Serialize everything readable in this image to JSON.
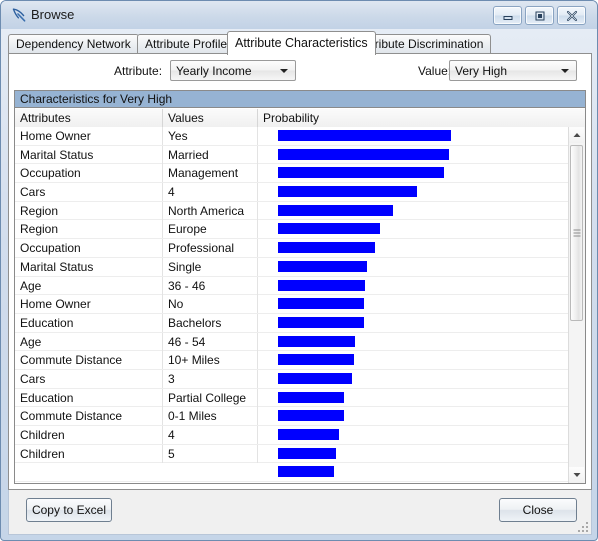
{
  "window": {
    "title": "Browse",
    "icon": "pickaxe-icon",
    "controls": {
      "minimize": "minimize-icon",
      "maximize": "restore-icon",
      "close": "close-icon"
    }
  },
  "tabs": [
    {
      "label": "Dependency Network",
      "active": false
    },
    {
      "label": "Attribute Profiles",
      "active": false
    },
    {
      "label": "Attribute Characteristics",
      "active": true
    },
    {
      "label": "Attribute Discrimination",
      "active": false
    }
  ],
  "selectors": {
    "attribute_label": "Attribute:",
    "attribute_value": "Yearly Income",
    "value_label": "Value:",
    "value_value": "Very High"
  },
  "grid": {
    "caption": "Characteristics for Very High",
    "columns": [
      "Attributes",
      "Values",
      "Probability"
    ],
    "rows": [
      {
        "attribute": "Home Owner",
        "value": "Yes",
        "probability": 0.985
      },
      {
        "attribute": "Marital Status",
        "value": "Married",
        "probability": 0.972
      },
      {
        "attribute": "Occupation",
        "value": "Management",
        "probability": 0.944
      },
      {
        "attribute": "Cars",
        "value": "4",
        "probability": 0.792
      },
      {
        "attribute": "Region",
        "value": "North America",
        "probability": 0.652
      },
      {
        "attribute": "Region",
        "value": "Europe",
        "probability": 0.578
      },
      {
        "attribute": "Occupation",
        "value": "Professional",
        "probability": 0.55
      },
      {
        "attribute": "Marital Status",
        "value": "Single",
        "probability": 0.505
      },
      {
        "attribute": "Age",
        "value": "36 - 46",
        "probability": 0.496
      },
      {
        "attribute": "Home Owner",
        "value": "No",
        "probability": 0.487
      },
      {
        "attribute": "Education",
        "value": "Bachelors",
        "probability": 0.487
      },
      {
        "attribute": "Age",
        "value": "46 - 54",
        "probability": 0.44
      },
      {
        "attribute": "Commute Distance",
        "value": "10+ Miles",
        "probability": 0.431
      },
      {
        "attribute": "Cars",
        "value": "3",
        "probability": 0.422
      },
      {
        "attribute": "Education",
        "value": "Partial College",
        "probability": 0.376
      },
      {
        "attribute": "Commute Distance",
        "value": "0-1 Miles",
        "probability": 0.376
      },
      {
        "attribute": "Children",
        "value": "4",
        "probability": 0.348
      },
      {
        "attribute": "Children",
        "value": "5",
        "probability": 0.33
      }
    ]
  },
  "footer": {
    "copy_label": "Copy to Excel",
    "close_label": "Close"
  },
  "colors": {
    "bar": "#0000FF",
    "caption_bg": "#96B3D3"
  }
}
